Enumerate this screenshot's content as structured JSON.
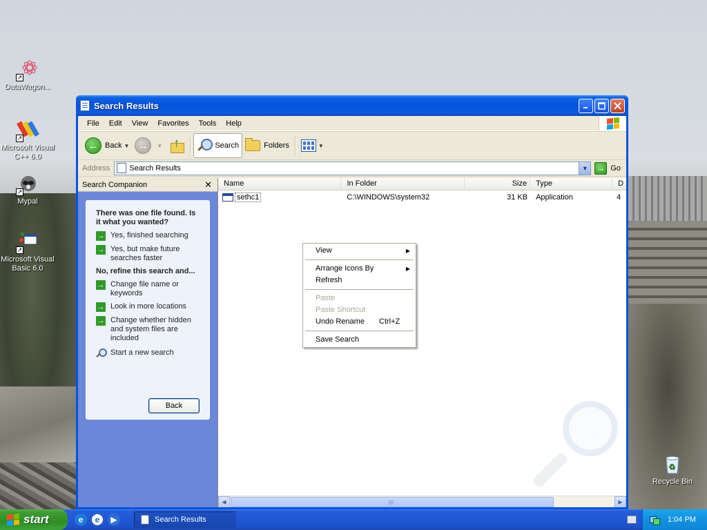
{
  "desktop": {
    "icons": [
      {
        "label": "DataWagon..."
      },
      {
        "label": "Microsoft Visual C++ 6.0"
      },
      {
        "label": "Mypal"
      },
      {
        "label": "Microsoft Visual Basic 6.0"
      },
      {
        "label": "Recycle Bin"
      }
    ]
  },
  "window": {
    "title": "Search Results",
    "menu": [
      "File",
      "Edit",
      "View",
      "Favorites",
      "Tools",
      "Help"
    ],
    "toolbar": {
      "back_label": "Back",
      "search_label": "Search",
      "folders_label": "Folders"
    },
    "address": {
      "label": "Address",
      "value": "Search Results",
      "go_label": "Go"
    }
  },
  "companion": {
    "header": "Search Companion",
    "close_glyph": "✕",
    "title1": "There was one file found. Is it what you wanted?",
    "options1": [
      "Yes, finished searching",
      "Yes, but make future searches faster"
    ],
    "title2": "No, refine this search and...",
    "options2": [
      "Change file name or keywords",
      "Look in more locations",
      "Change whether hidden and system files are included"
    ],
    "new_search": "Start a new search",
    "back_button": "Back"
  },
  "results": {
    "columns": [
      "Name",
      "In Folder",
      "Size",
      "Type",
      "D"
    ],
    "rows": [
      {
        "name": "sethc1",
        "folder": "C:\\WINDOWS\\system32",
        "size": "31 KB",
        "type": "Application",
        "date": "4"
      }
    ]
  },
  "context_menu": {
    "view": "View",
    "arrange": "Arrange Icons By",
    "refresh": "Refresh",
    "paste": "Paste",
    "paste_shortcut": "Paste Shortcut",
    "undo_rename": "Undo Rename",
    "undo_shortcut": "Ctrl+Z",
    "save_search": "Save Search"
  },
  "taskbar": {
    "start_label": "start",
    "task_label": "Search Results",
    "clock": "1:04 PM"
  },
  "colors": {
    "titlebar": "#0553d8",
    "companion_bg": "#6b87da",
    "taskbar": "#245edb",
    "start_green": "#3d9c31"
  }
}
